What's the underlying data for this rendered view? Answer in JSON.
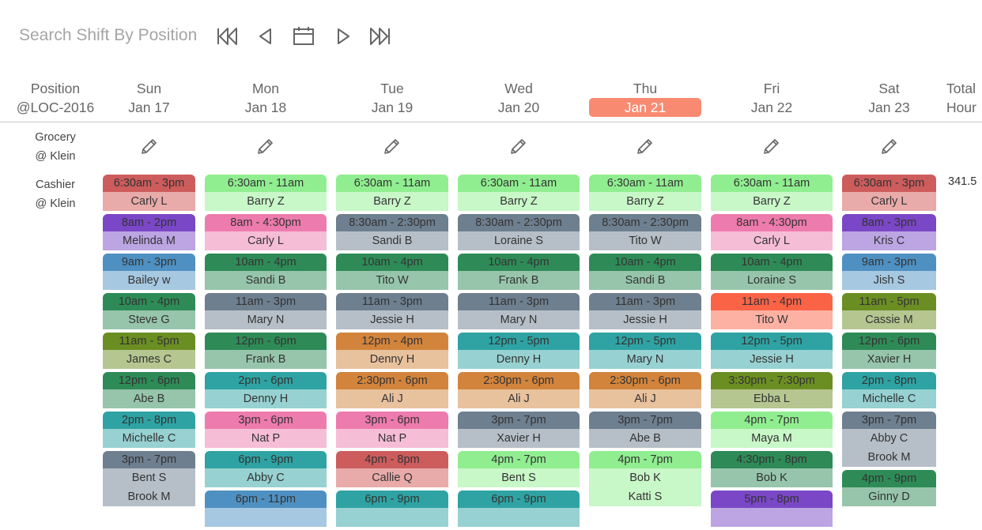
{
  "toolbar": {
    "title": "Search Shift By Position",
    "buttons": [
      "first-week",
      "previous-week",
      "calendar",
      "next-week",
      "last-week"
    ]
  },
  "header": {
    "position_label": "Position",
    "location_label": "@LOC-2016",
    "days": [
      {
        "day": "Sun",
        "date": "Jan 17",
        "today": false
      },
      {
        "day": "Mon",
        "date": "Jan 18",
        "today": false
      },
      {
        "day": "Tue",
        "date": "Jan 19",
        "today": false
      },
      {
        "day": "Wed",
        "date": "Jan 20",
        "today": false
      },
      {
        "day": "Thu",
        "date": "Jan 21",
        "today": true
      },
      {
        "day": "Fri",
        "date": "Jan 22",
        "today": false
      },
      {
        "day": "Sat",
        "date": "Jan 23",
        "today": false
      }
    ],
    "total_label_1": "Total",
    "total_label_2": "Hour"
  },
  "colors": {
    "red": [
      "#cd5c5c",
      "#e9aaaa"
    ],
    "purple": [
      "#7a47c6",
      "#bca5e2"
    ],
    "blue": [
      "#4f90c2",
      "#a6c8e1"
    ],
    "green": [
      "#2e8b57",
      "#96c5ab"
    ],
    "olive": [
      "#6b8e23",
      "#b5c691"
    ],
    "teal": [
      "#2fa3a3",
      "#97d1d1"
    ],
    "slate": [
      "#6e7f8f",
      "#b6bfc7"
    ],
    "lightgreen": [
      "#90ee90",
      "#c8f7c8"
    ],
    "pink": [
      "#ee7bad",
      "#f6bdd6"
    ],
    "orange": [
      "#d2843c",
      "#e8c19d"
    ],
    "tomato": [
      "#fb6347",
      "#fdb1a3"
    ]
  },
  "rows": [
    {
      "name": "Grocery",
      "location": "@ Klein"
    },
    {
      "name": "Cashier",
      "location": "@ Klein",
      "total": "341.5"
    }
  ],
  "schedule": [
    [
      {
        "time": "6:30am - 3pm",
        "people": [
          "Carly L"
        ],
        "color": "red"
      },
      {
        "time": "8am - 2pm",
        "people": [
          "Melinda M"
        ],
        "color": "purple"
      },
      {
        "time": "9am - 3pm",
        "people": [
          "Bailey w"
        ],
        "color": "blue"
      },
      {
        "time": "10am - 4pm",
        "people": [
          "Steve G"
        ],
        "color": "green"
      },
      {
        "time": "11am - 5pm",
        "people": [
          "James C"
        ],
        "color": "olive"
      },
      {
        "time": "12pm - 6pm",
        "people": [
          "Abe B"
        ],
        "color": "green"
      },
      {
        "time": "2pm - 8pm",
        "people": [
          "Michelle C"
        ],
        "color": "teal"
      },
      {
        "time": "3pm - 7pm",
        "people": [
          "Bent S",
          "Brook M"
        ],
        "color": "slate"
      }
    ],
    [
      {
        "time": "6:30am - 11am",
        "people": [
          "Barry Z"
        ],
        "color": "lightgreen"
      },
      {
        "time": "8am - 4:30pm",
        "people": [
          "Carly L"
        ],
        "color": "pink"
      },
      {
        "time": "10am - 4pm",
        "people": [
          "Sandi B"
        ],
        "color": "green"
      },
      {
        "time": "11am - 3pm",
        "people": [
          "Mary N"
        ],
        "color": "slate"
      },
      {
        "time": "12pm - 6pm",
        "people": [
          "Frank B"
        ],
        "color": "green"
      },
      {
        "time": "2pm - 6pm",
        "people": [
          "Denny H"
        ],
        "color": "teal"
      },
      {
        "time": "3pm - 6pm",
        "people": [
          "Nat P"
        ],
        "color": "pink"
      },
      {
        "time": "6pm - 9pm",
        "people": [
          "Abby C"
        ],
        "color": "teal"
      },
      {
        "time": "6pm - 11pm",
        "people": [
          ""
        ],
        "color": "blue"
      }
    ],
    [
      {
        "time": "6:30am - 11am",
        "people": [
          "Barry Z"
        ],
        "color": "lightgreen"
      },
      {
        "time": "8:30am - 2:30pm",
        "people": [
          "Sandi B"
        ],
        "color": "slate"
      },
      {
        "time": "10am - 4pm",
        "people": [
          "Tito W"
        ],
        "color": "green"
      },
      {
        "time": "11am - 3pm",
        "people": [
          "Jessie H"
        ],
        "color": "slate"
      },
      {
        "time": "12pm - 4pm",
        "people": [
          "Denny H"
        ],
        "color": "orange"
      },
      {
        "time": "2:30pm - 6pm",
        "people": [
          "Ali J"
        ],
        "color": "orange"
      },
      {
        "time": "3pm - 6pm",
        "people": [
          "Nat P"
        ],
        "color": "pink"
      },
      {
        "time": "4pm - 8pm",
        "people": [
          "Callie Q"
        ],
        "color": "red"
      },
      {
        "time": "6pm - 9pm",
        "people": [
          ""
        ],
        "color": "teal"
      }
    ],
    [
      {
        "time": "6:30am - 11am",
        "people": [
          "Barry Z"
        ],
        "color": "lightgreen"
      },
      {
        "time": "8:30am - 2:30pm",
        "people": [
          "Loraine S"
        ],
        "color": "slate"
      },
      {
        "time": "10am - 4pm",
        "people": [
          "Frank B"
        ],
        "color": "green"
      },
      {
        "time": "11am - 3pm",
        "people": [
          "Mary N"
        ],
        "color": "slate"
      },
      {
        "time": "12pm - 5pm",
        "people": [
          "Denny H"
        ],
        "color": "teal"
      },
      {
        "time": "2:30pm - 6pm",
        "people": [
          "Ali J"
        ],
        "color": "orange"
      },
      {
        "time": "3pm - 7pm",
        "people": [
          "Xavier H"
        ],
        "color": "slate"
      },
      {
        "time": "4pm - 7pm",
        "people": [
          "Bent S"
        ],
        "color": "lightgreen"
      },
      {
        "time": "6pm - 9pm",
        "people": [
          ""
        ],
        "color": "teal"
      }
    ],
    [
      {
        "time": "6:30am - 11am",
        "people": [
          "Barry Z"
        ],
        "color": "lightgreen"
      },
      {
        "time": "8:30am - 2:30pm",
        "people": [
          "Tito W"
        ],
        "color": "slate"
      },
      {
        "time": "10am - 4pm",
        "people": [
          "Sandi B"
        ],
        "color": "green"
      },
      {
        "time": "11am - 3pm",
        "people": [
          "Jessie H"
        ],
        "color": "slate"
      },
      {
        "time": "12pm - 5pm",
        "people": [
          "Mary N"
        ],
        "color": "teal"
      },
      {
        "time": "2:30pm - 6pm",
        "people": [
          "Ali J"
        ],
        "color": "orange"
      },
      {
        "time": "3pm - 7pm",
        "people": [
          "Abe B"
        ],
        "color": "slate"
      },
      {
        "time": "4pm - 7pm",
        "people": [
          "Bob K",
          "Katti S"
        ],
        "color": "lightgreen"
      }
    ],
    [
      {
        "time": "6:30am - 11am",
        "people": [
          "Barry Z"
        ],
        "color": "lightgreen"
      },
      {
        "time": "8am - 4:30pm",
        "people": [
          "Carly L"
        ],
        "color": "pink"
      },
      {
        "time": "10am - 4pm",
        "people": [
          "Loraine S"
        ],
        "color": "green"
      },
      {
        "time": "11am - 4pm",
        "people": [
          "Tito W"
        ],
        "color": "tomato"
      },
      {
        "time": "12pm - 5pm",
        "people": [
          "Jessie H"
        ],
        "color": "teal"
      },
      {
        "time": "3:30pm - 7:30pm",
        "people": [
          "Ebba L"
        ],
        "color": "olive"
      },
      {
        "time": "4pm - 7pm",
        "people": [
          "Maya M"
        ],
        "color": "lightgreen"
      },
      {
        "time": "4:30pm - 8pm",
        "people": [
          "Bob K"
        ],
        "color": "green"
      },
      {
        "time": "5pm - 8pm",
        "people": [
          ""
        ],
        "color": "purple"
      }
    ],
    [
      {
        "time": "6:30am - 3pm",
        "people": [
          "Carly L"
        ],
        "color": "red"
      },
      {
        "time": "8am - 3pm",
        "people": [
          "Kris C"
        ],
        "color": "purple"
      },
      {
        "time": "9am - 3pm",
        "people": [
          "Jish S"
        ],
        "color": "blue"
      },
      {
        "time": "11am - 5pm",
        "people": [
          "Cassie M"
        ],
        "color": "olive"
      },
      {
        "time": "12pm - 6pm",
        "people": [
          "Xavier H"
        ],
        "color": "green"
      },
      {
        "time": "2pm - 8pm",
        "people": [
          "Michelle C"
        ],
        "color": "teal"
      },
      {
        "time": "3pm - 7pm",
        "people": [
          "Abby C",
          "Brook M"
        ],
        "color": "slate"
      },
      {
        "time": "4pm - 9pm",
        "people": [
          "Ginny D"
        ],
        "color": "green"
      }
    ]
  ]
}
